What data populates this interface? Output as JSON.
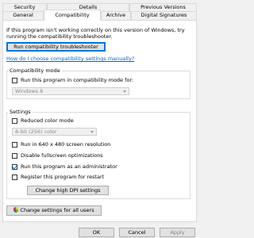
{
  "tabs_back": [
    {
      "label": "Security"
    },
    {
      "label": "Details"
    },
    {
      "label": "Previous Versions"
    }
  ],
  "tabs_front": [
    {
      "label": "General"
    },
    {
      "label": "Compatibility"
    },
    {
      "label": "Archive"
    },
    {
      "label": "Digital Signatures"
    }
  ],
  "active_tab": "Compatibility",
  "intro_text": "If this program isn't working correctly on this version of Windows, try running the compatibility troubleshooter.",
  "run_troubleshooter_label": "Run compatibility troubleshooter",
  "manual_link": "How do I choose compatibility settings manually?",
  "compat_mode": {
    "group_label": "Compatibility mode",
    "checkbox_label": "Run this program in compatibility mode for:",
    "checked": false,
    "select_value": "Windows 8"
  },
  "settings": {
    "group_label": "Settings",
    "reduced_color": {
      "label": "Reduced color mode",
      "checked": false
    },
    "color_select_value": "8-bit (256) color",
    "res_640": {
      "label": "Run in 640 x 480 screen resolution",
      "checked": false
    },
    "disable_fullscreen": {
      "label": "Disable fullscreen optimizations",
      "checked": false
    },
    "run_admin": {
      "label": "Run this program as an administrator",
      "checked": true
    },
    "register_restart": {
      "label": "Register this program for restart",
      "checked": false
    },
    "dpi_button": "Change high DPI settings"
  },
  "all_users_button": "Change settings for all users",
  "footer": {
    "ok": "OK",
    "cancel": "Cancel",
    "apply": "Apply"
  },
  "colors": {
    "link": "#0066cc",
    "focus": "#0078d7",
    "panel_bg": "#ffffff",
    "window_bg": "#f0f0f0"
  },
  "icons": {
    "all_users_button": "uac-shield-icon"
  }
}
